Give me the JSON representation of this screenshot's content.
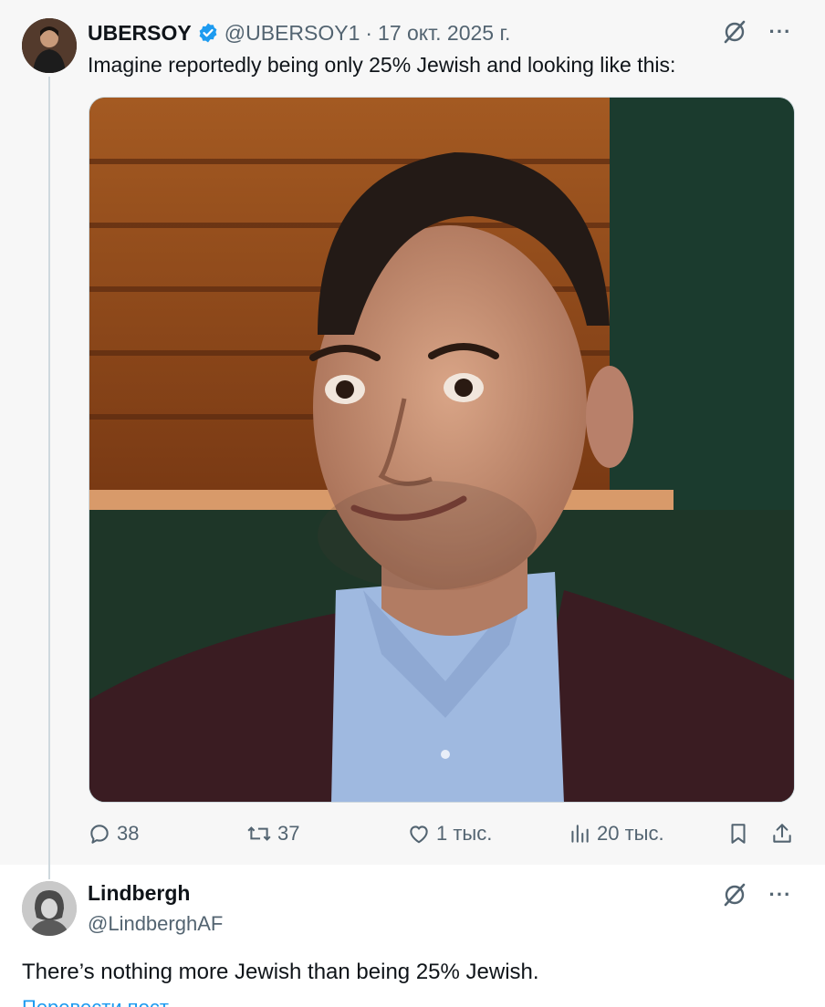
{
  "original_tweet": {
    "display_name": "UBERSOY",
    "handle": "@UBERSOY1",
    "separator": "·",
    "date": "17 окт. 2025 г.",
    "text": "Imagine reportedly being only 25% Jewish and looking like this:",
    "more_label": "···",
    "actions": {
      "replies": "38",
      "retweets": "37",
      "likes": "1 тыс.",
      "views": "20 тыс."
    }
  },
  "reply_tweet": {
    "display_name": "Lindbergh",
    "handle": "@LindberghAF",
    "text": "There’s nothing more Jewish than being 25% Jewish.",
    "more_label": "···",
    "translate_label": "Перевести пост"
  },
  "colors": {
    "accent": "#1d9bf0",
    "muted_text": "#536471",
    "primary_text": "#0f1419"
  }
}
